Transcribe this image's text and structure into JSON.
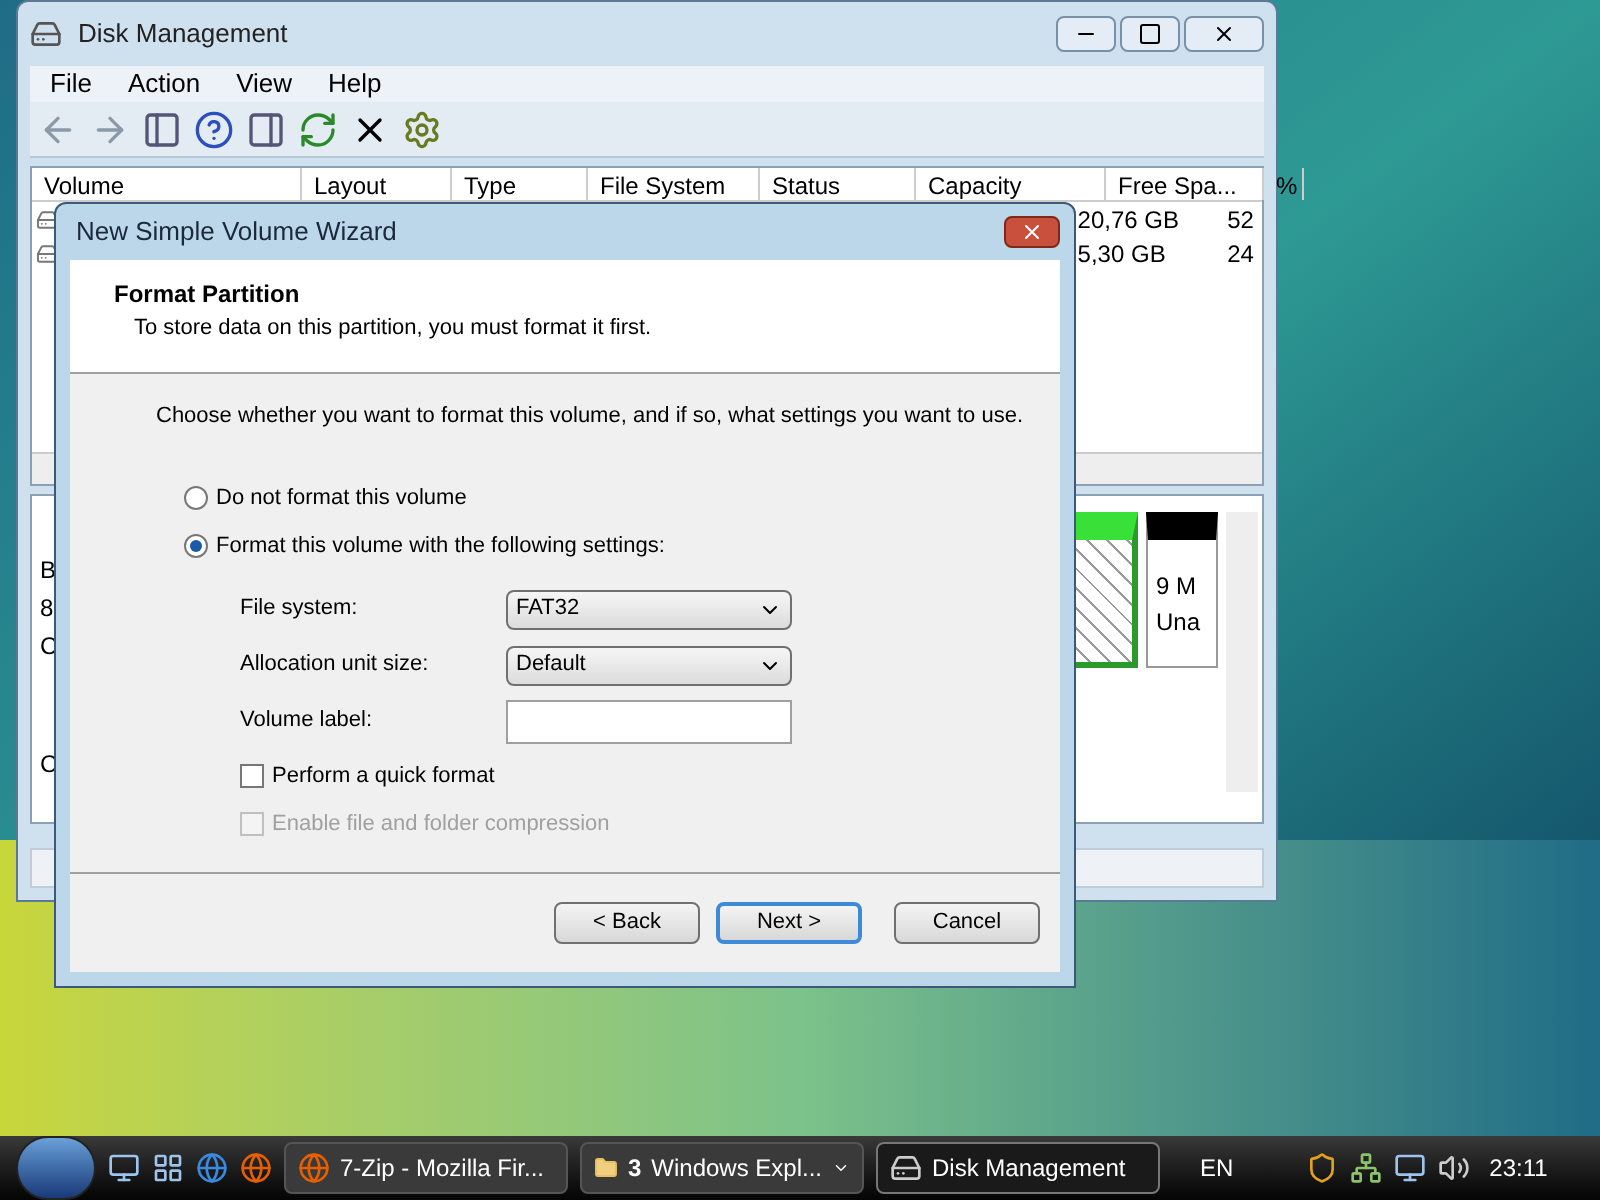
{
  "disk_management": {
    "title": "Disk Management",
    "menu": [
      "File",
      "Action",
      "View",
      "Help"
    ],
    "columns": [
      "Volume",
      "Layout",
      "Type",
      "File System",
      "Status",
      "Capacity",
      "Free Spa...",
      "%"
    ],
    "rows": [
      {
        "free_space": "20,76 GB",
        "percent_free": "52"
      },
      {
        "free_space": "5,30 GB",
        "percent_free": "24"
      }
    ],
    "disk_pane": {
      "left_fragments": [
        "B",
        "8",
        "C",
        "C"
      ],
      "partition_lines": [
        "9 M",
        "Una"
      ]
    }
  },
  "wizard": {
    "title": "New Simple Volume Wizard",
    "heading": "Format Partition",
    "subtitle": "To store data on this partition, you must format it first.",
    "prompt": "Choose whether you want to format this volume, and if so, what settings you want to use.",
    "options": [
      {
        "label": "Do not format this volume",
        "selected": false
      },
      {
        "label": "Format this volume with the following settings:",
        "selected": true
      }
    ],
    "settings": [
      {
        "kind": "select",
        "label": "File system:",
        "value": "FAT32"
      },
      {
        "kind": "select",
        "label": "Allocation unit size:",
        "value": "Default"
      },
      {
        "kind": "text",
        "label": "Volume label:"
      }
    ],
    "checkboxes": [
      {
        "label": "Perform a quick format",
        "checked": false,
        "disabled": false
      },
      {
        "label": "Enable file and folder compression",
        "checked": false,
        "disabled": true
      }
    ],
    "buttons": [
      {
        "label": "< Back",
        "default": false
      },
      {
        "label": "Next >",
        "default": true
      },
      {
        "label": "Cancel",
        "default": false
      }
    ]
  },
  "taskbar": {
    "tasks": [
      {
        "label": "7-Zip - Mozilla Fir...",
        "selected": false
      },
      {
        "count": "3",
        "label": "Windows Expl...",
        "selected": false
      },
      {
        "label": "Disk Management",
        "selected": true
      }
    ],
    "language": "EN",
    "clock": "23:11"
  }
}
